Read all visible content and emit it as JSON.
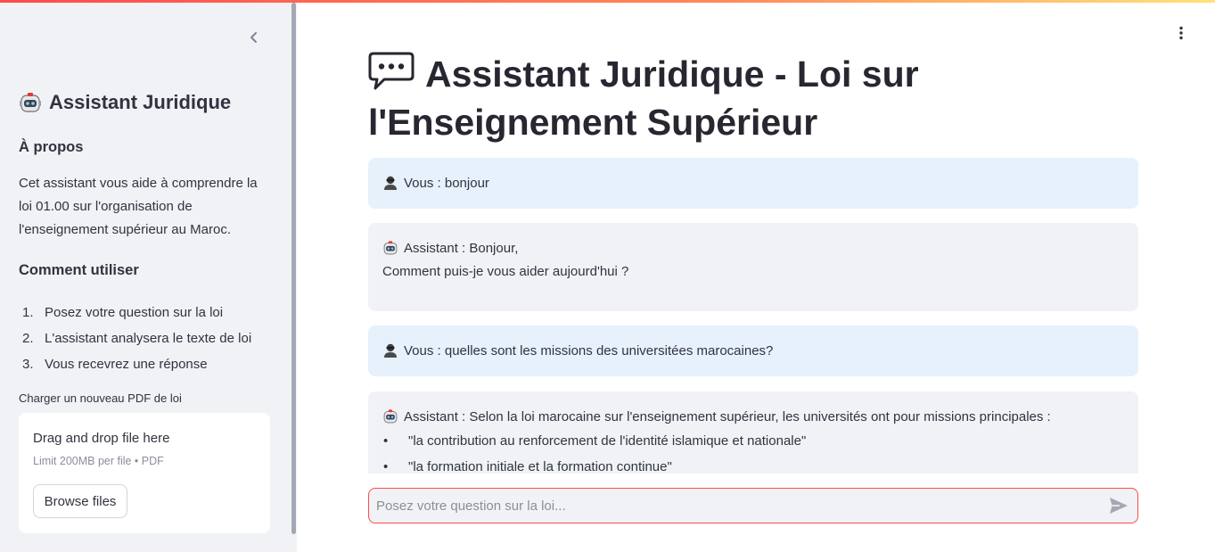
{
  "sidebar": {
    "title": "Assistant Juridique",
    "about_heading": "À propos",
    "about_text": "Cet assistant vous aide à comprendre la loi 01.00 sur l'organisation de l'enseignement supérieur au Maroc.",
    "howto_heading": "Comment utiliser",
    "steps": [
      {
        "num": "1.",
        "text": "Posez votre question sur la loi"
      },
      {
        "num": "2.",
        "text": "L'assistant analysera le texte de loi"
      },
      {
        "num": "3.",
        "text": "Vous recevrez une réponse"
      }
    ],
    "upload_label": "Charger un nouveau PDF de loi",
    "dropzone_title": "Drag and drop file here",
    "dropzone_limit": "Limit 200MB per file • PDF",
    "browse_label": "Browse files"
  },
  "main": {
    "title": "Assistant Juridique - Loi sur l'Enseignement Supérieur",
    "messages": [
      {
        "role": "user",
        "text": "Vous : bonjour"
      },
      {
        "role": "assistant",
        "lines": [
          "Assistant : Bonjour,",
          "Comment puis-je vous aider aujourd'hui ?"
        ]
      },
      {
        "role": "user",
        "text": "Vous : quelles sont les missions des universitées marocaines?"
      },
      {
        "role": "assistant",
        "intro": "Assistant : Selon la loi marocaine sur l'enseignement supérieur, les universités ont pour missions principales :",
        "bullets": [
          "\"la contribution au renforcement de l'identité islamique et nationale\"",
          "\"la formation initiale et la formation continue\""
        ]
      }
    ],
    "input_placeholder": "Posez votre question sur la loi..."
  },
  "colors": {
    "accent": "#ff4b4b",
    "sidebar_bg": "#f0f2f6",
    "user_msg_bg": "#e6f1fc",
    "assistant_msg_bg": "#f0f2f6"
  },
  "icons": {
    "title": "speech-bubble-icon",
    "sidebar_title": "robot-icon",
    "user_avatar": "person-icon",
    "assistant_avatar": "robot-icon",
    "collapse": "chevron-left-icon",
    "menu": "kebab-menu-icon",
    "send": "send-icon"
  }
}
